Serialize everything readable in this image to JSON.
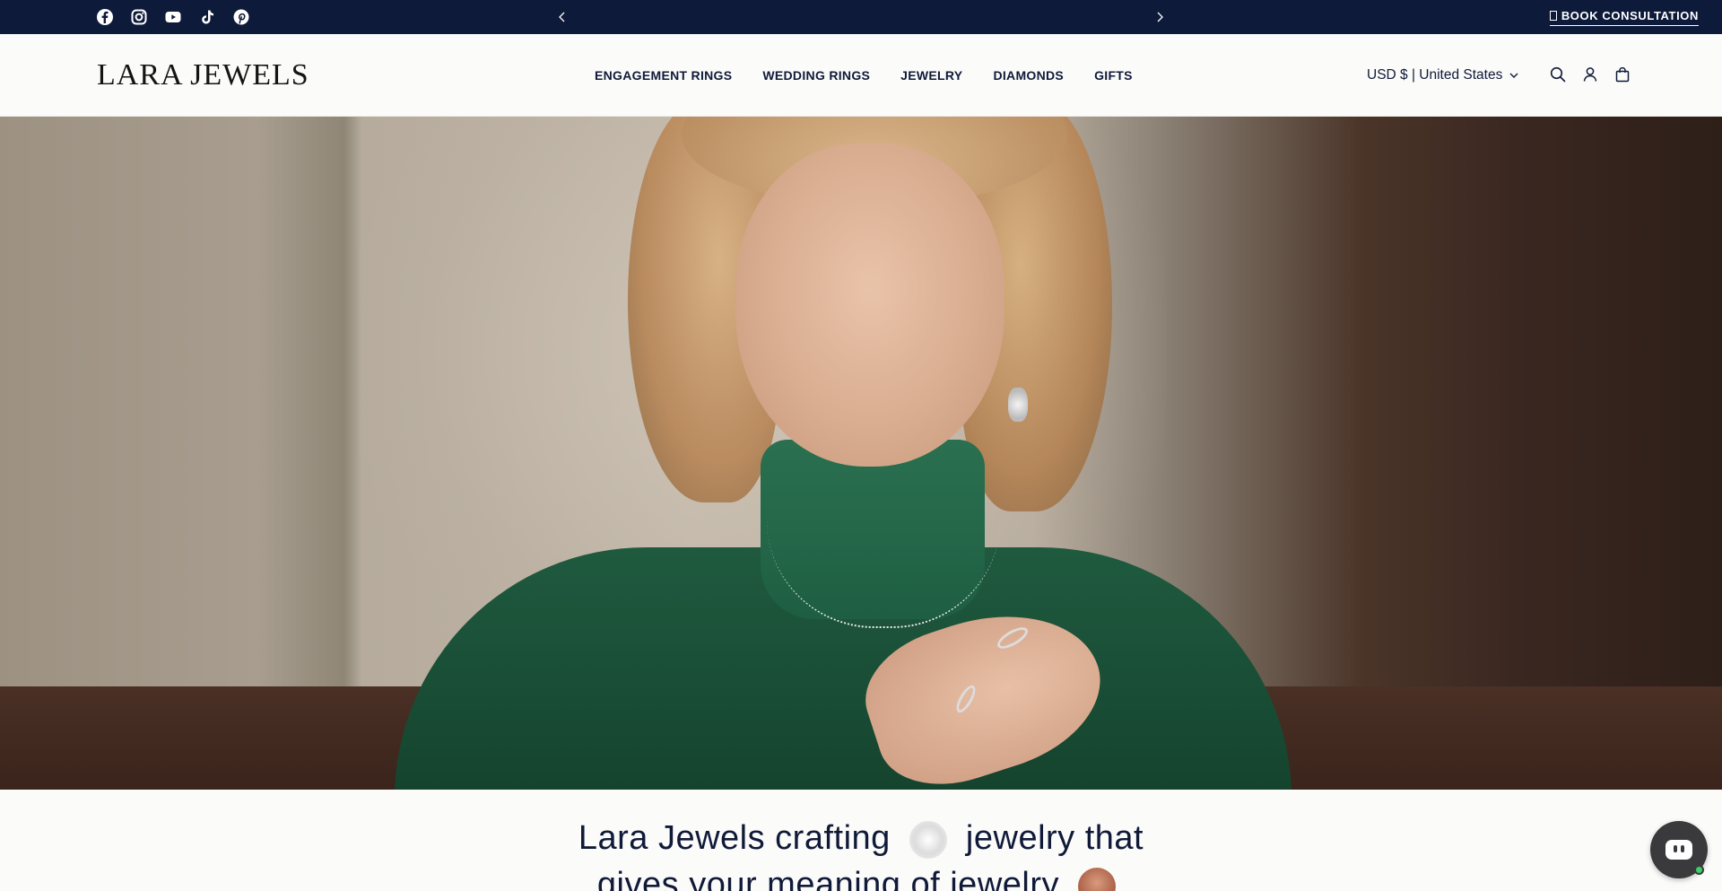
{
  "topbar": {
    "social_icons": [
      "facebook-icon",
      "instagram-icon",
      "youtube-icon",
      "tiktok-icon",
      "pinterest-icon"
    ],
    "consultation_label": "BOOK CONSULTATION"
  },
  "header": {
    "logo": "LARA JEWELS",
    "nav": [
      "ENGAGEMENT RINGS",
      "WEDDING RINGS",
      "JEWELRY",
      "DIAMONDS",
      "GIFTS"
    ],
    "currency": "USD $ | United States",
    "icons": [
      "search-icon",
      "account-icon",
      "cart-icon"
    ]
  },
  "tagline": {
    "line1_a": "Lara Jewels crafting",
    "line1_b": "jewelry that",
    "line2": "gives your meaning of jewelry"
  },
  "colors": {
    "topbar_bg": "#0e1a3a",
    "text": "#101a38",
    "chat_online": "#3ad16b"
  }
}
